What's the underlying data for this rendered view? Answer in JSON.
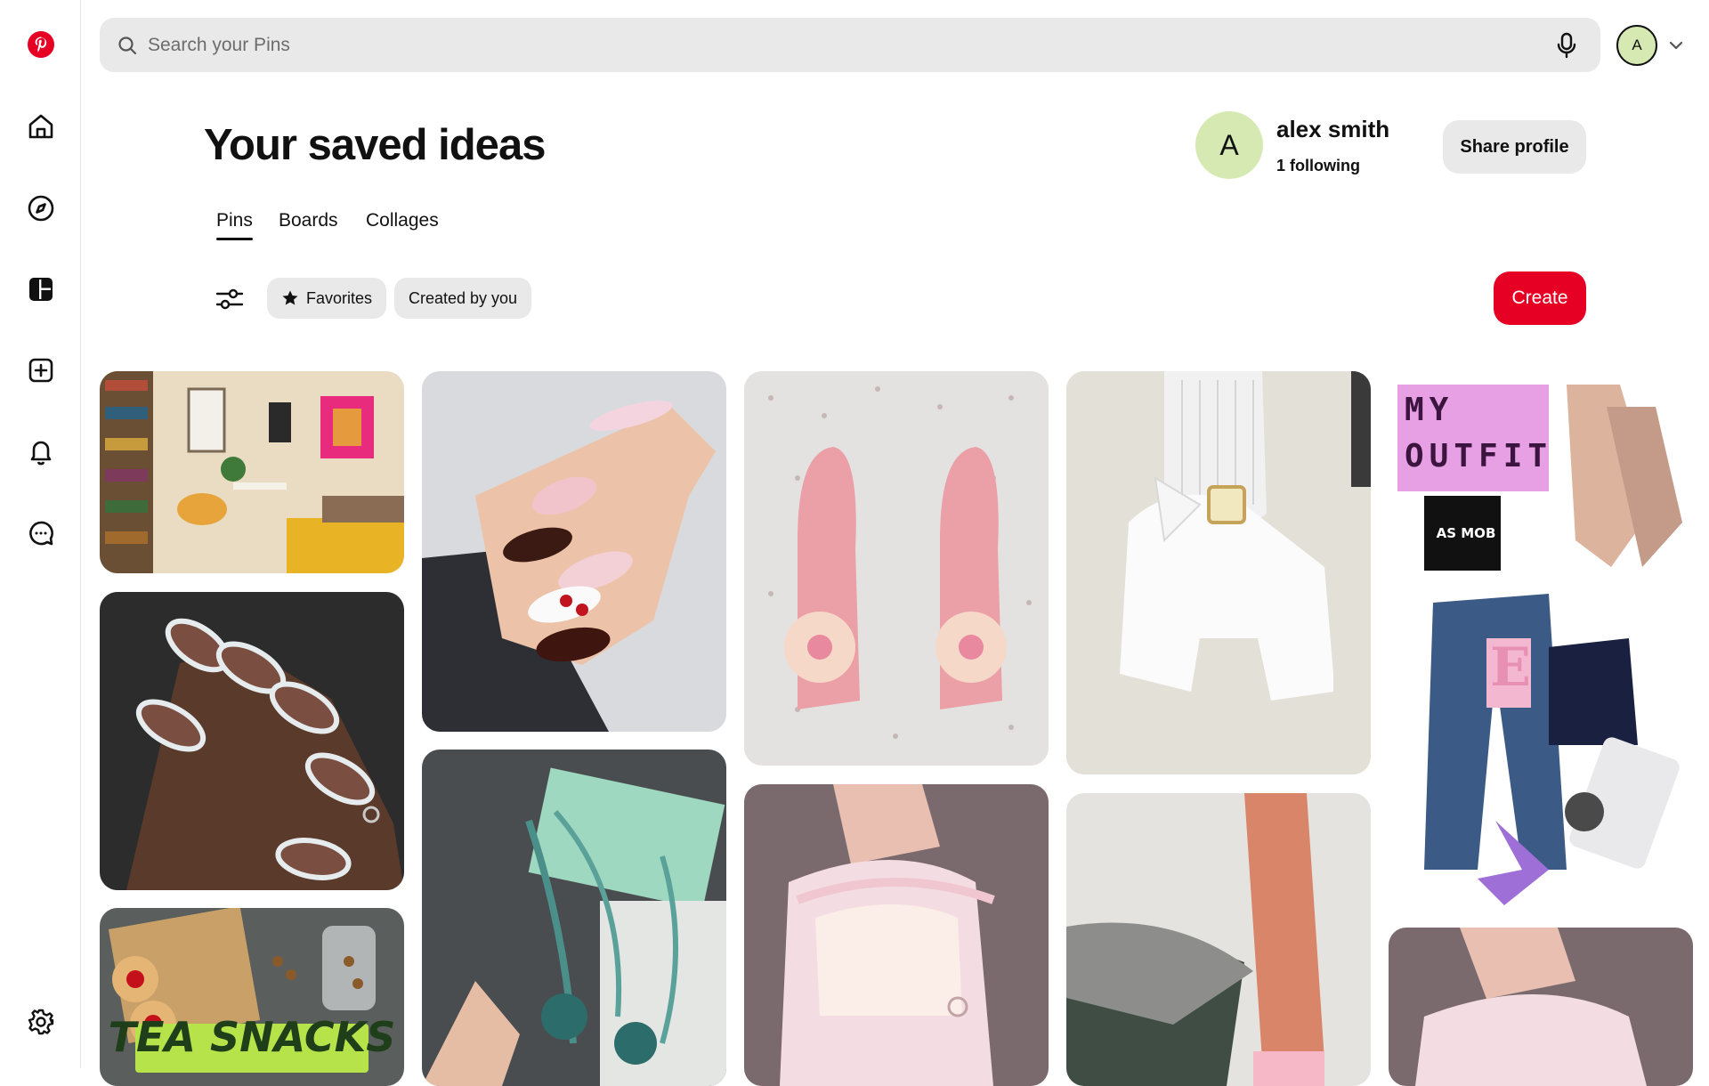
{
  "app": {
    "name": "Pinterest",
    "brand_color": "#e60023"
  },
  "nav": {
    "items": [
      {
        "name": "home",
        "icon": "home-icon"
      },
      {
        "name": "explore",
        "icon": "compass-icon"
      },
      {
        "name": "boards",
        "icon": "dashboard-icon"
      },
      {
        "name": "create",
        "icon": "plus-square-icon"
      },
      {
        "name": "notifications",
        "icon": "bell-icon"
      },
      {
        "name": "messages",
        "icon": "chat-icon"
      },
      {
        "name": "settings",
        "icon": "gear-icon"
      }
    ]
  },
  "search": {
    "placeholder": "Search your Pins",
    "value": ""
  },
  "account": {
    "avatar_initial": "A"
  },
  "header": {
    "title": "Your saved ideas"
  },
  "profile": {
    "avatar_initial": "A",
    "name": "alex smith",
    "following": "1 following",
    "share_label": "Share profile"
  },
  "tabs": [
    {
      "label": "Pins",
      "active": true
    },
    {
      "label": "Boards",
      "active": false
    },
    {
      "label": "Collages",
      "active": false
    }
  ],
  "filters": {
    "favorites": "Favorites",
    "created_by_you": "Created by you"
  },
  "create_label": "Create",
  "pins": [
    {
      "subject": "cozy bedroom with bookshelves"
    },
    {
      "subject": "dark nails with french tips"
    },
    {
      "subject": "tea snacks",
      "caption": "TEA SNACKS"
    },
    {
      "subject": "cherry nail art"
    },
    {
      "subject": "teal flower heels"
    },
    {
      "subject": "pink orchid sandals"
    },
    {
      "subject": "pink ballet sandals"
    },
    {
      "subject": "white platform mary janes"
    },
    {
      "subject": "legs on bed"
    },
    {
      "subject": "my outfit collage",
      "caption_line1": "MY",
      "caption_line2": "OUTFIT",
      "sticker": "AS MOB",
      "letter": "E"
    },
    {
      "subject": "pink shoes"
    }
  ]
}
